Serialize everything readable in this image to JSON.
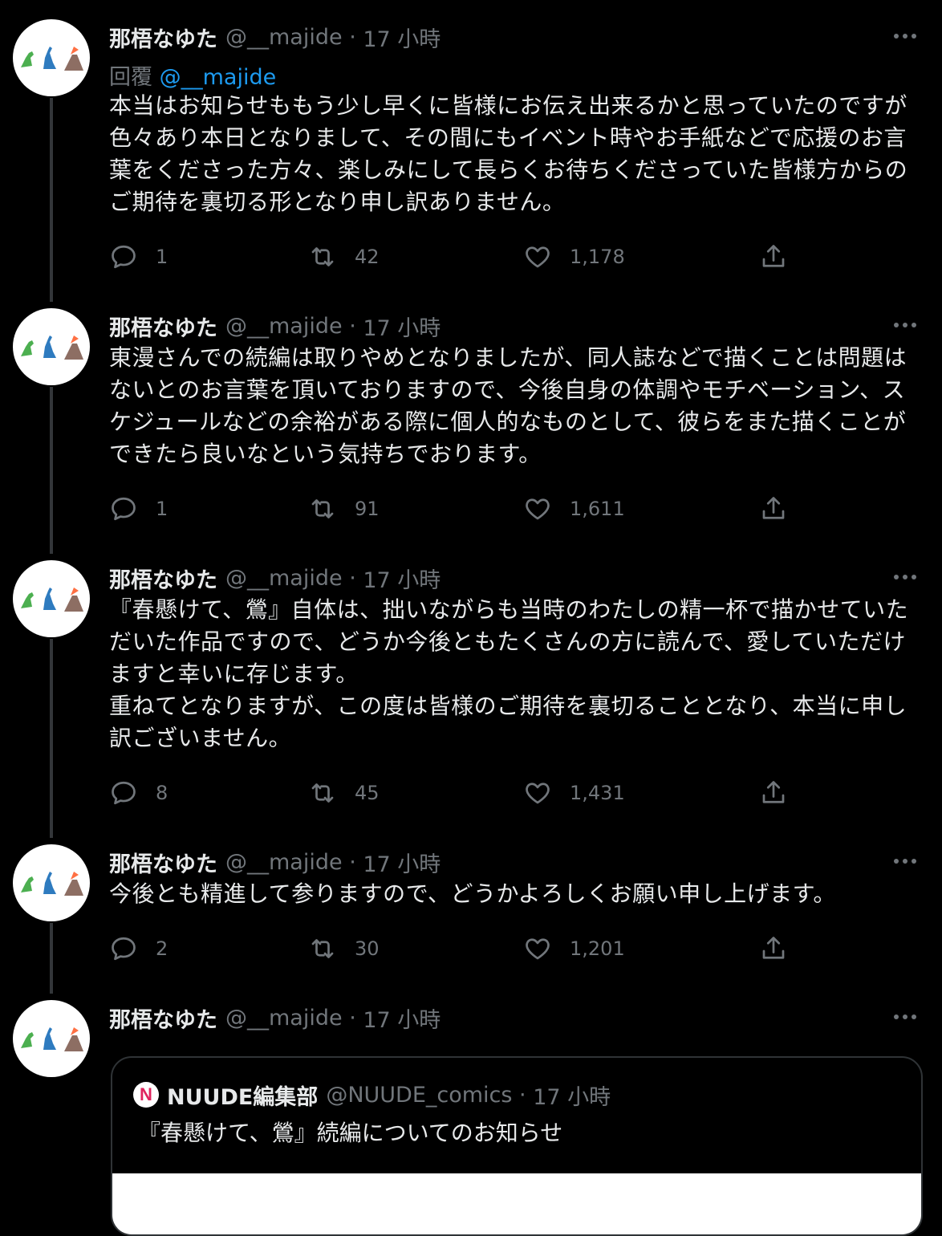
{
  "author": {
    "name": "那梧なゆた",
    "handle": "@__majide",
    "time": "17 小時"
  },
  "tweets": [
    {
      "reply_label": "回覆",
      "reply_handle": "@__majide",
      "text": "本当はお知らせももう少し早くに皆様にお伝え出来るかと思っていたのですが色々あり本日となりまして、その間にもイベント時やお手紙などで応援のお言葉をくださった方々、楽しみにして長らくお待ちくださっていた皆様方からのご期待を裏切る形となり申し訳ありません。",
      "replies": "1",
      "retweets": "42",
      "likes": "1,178"
    },
    {
      "text": "東漫さんでの続編は取りやめとなりましたが、同人誌などで描くことは問題はないとのお言葉を頂いておりますので、今後自身の体調やモチベーション、スケジュールなどの余裕がある際に個人的なものとして、彼らをまた描くことができたら良いなという気持ちでおります。",
      "replies": "1",
      "retweets": "91",
      "likes": "1,611"
    },
    {
      "text": "『春懸けて、鶯』自体は、拙いながらも当時のわたしの精一杯で描かせていただいた作品ですので、どうか今後ともたくさんの方に読んで、愛していただけますと幸いに存じます。\n重ねてとなりますが、この度は皆様のご期待を裏切ることとなり、本当に申し訳ございません。",
      "replies": "8",
      "retweets": "45",
      "likes": "1,431"
    },
    {
      "text": "今後とも精進して参りますので、どうかよろしくお願い申し上げます。",
      "replies": "2",
      "retweets": "30",
      "likes": "1,201"
    },
    {}
  ],
  "quote": {
    "name": "NUUDE編集部",
    "handle": "@NUUDE_comics",
    "time": "17 小時",
    "text": "『春懸けて、鶯』続編についてのお知らせ",
    "logo_letter": "N"
  },
  "colors": {
    "background": "#000000",
    "text": "#e7e9ea",
    "muted": "#71767b",
    "link": "#1d9bf0",
    "border": "#2f3336"
  },
  "icons": [
    "reply-icon",
    "retweet-icon",
    "like-icon",
    "share-icon",
    "more-icon",
    "avatar-emoji-dinosaurs-volcano"
  ]
}
